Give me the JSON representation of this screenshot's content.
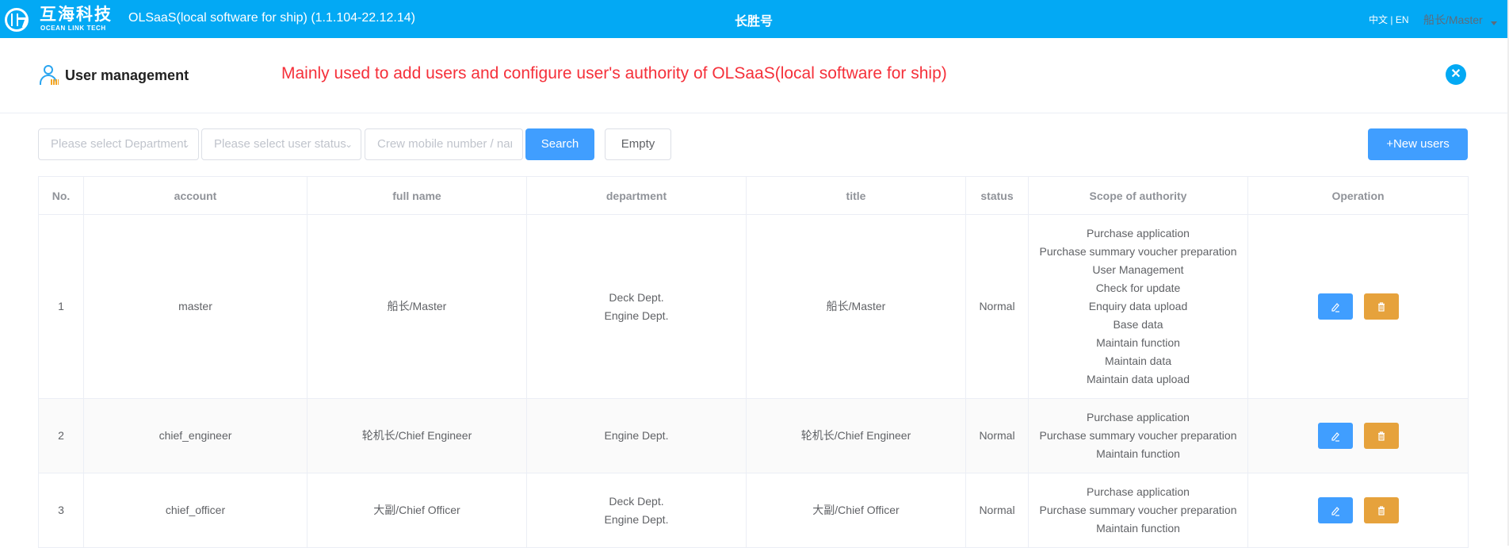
{
  "topbar": {
    "logo_cn": "互海科技",
    "logo_en": "OCEAN LINK TECH",
    "app_title": "OLSaaS(local software for ship)  (1.1.104-22.12.14)",
    "ship_name": "长胜号",
    "lang_cn": "中文",
    "lang_sep": " | ",
    "lang_en": "EN",
    "user": "船长/Master"
  },
  "page": {
    "title": "User management",
    "description": "Mainly used to add users and configure user's authority of OLSaaS(local software for ship)",
    "close_glyph": "✕"
  },
  "filters": {
    "department_placeholder": "Please select Department",
    "status_placeholder": "Please select user status",
    "search_placeholder": "Crew mobile number / name",
    "search_label": "Search",
    "empty_label": "Empty",
    "new_label": "+New users"
  },
  "table": {
    "headers": [
      "No.",
      "account",
      "full name",
      "department",
      "title",
      "status",
      "Scope of authority",
      "Operation"
    ],
    "rows": [
      {
        "no": "1",
        "account": "master",
        "full_name": "船长/Master",
        "departments": [
          "Deck Dept.",
          "Engine Dept."
        ],
        "title": "船长/Master",
        "status": "Normal",
        "scope": [
          "Purchase application",
          "Purchase summary voucher preparation",
          "User Management",
          "Check for update",
          "Enquiry data upload",
          "Base data",
          "Maintain function",
          "Maintain data",
          "Maintain data upload"
        ]
      },
      {
        "no": "2",
        "account": "chief_engineer",
        "full_name": "轮机长/Chief Engineer",
        "departments": [
          "Engine Dept."
        ],
        "title": "轮机长/Chief Engineer",
        "status": "Normal",
        "scope": [
          "Purchase application",
          "Purchase summary voucher preparation",
          "Maintain function"
        ]
      },
      {
        "no": "3",
        "account": "chief_officer",
        "full_name": "大副/Chief Officer",
        "departments": [
          "Deck Dept.",
          "Engine Dept."
        ],
        "title": "大副/Chief Officer",
        "status": "Normal",
        "scope": [
          "Purchase application",
          "Purchase summary voucher preparation",
          "Maintain function"
        ]
      }
    ]
  },
  "colors": {
    "topbar": "#03A9F4",
    "primary": "#409EFF",
    "warning": "#E6A23C",
    "description": "#F5303A"
  }
}
